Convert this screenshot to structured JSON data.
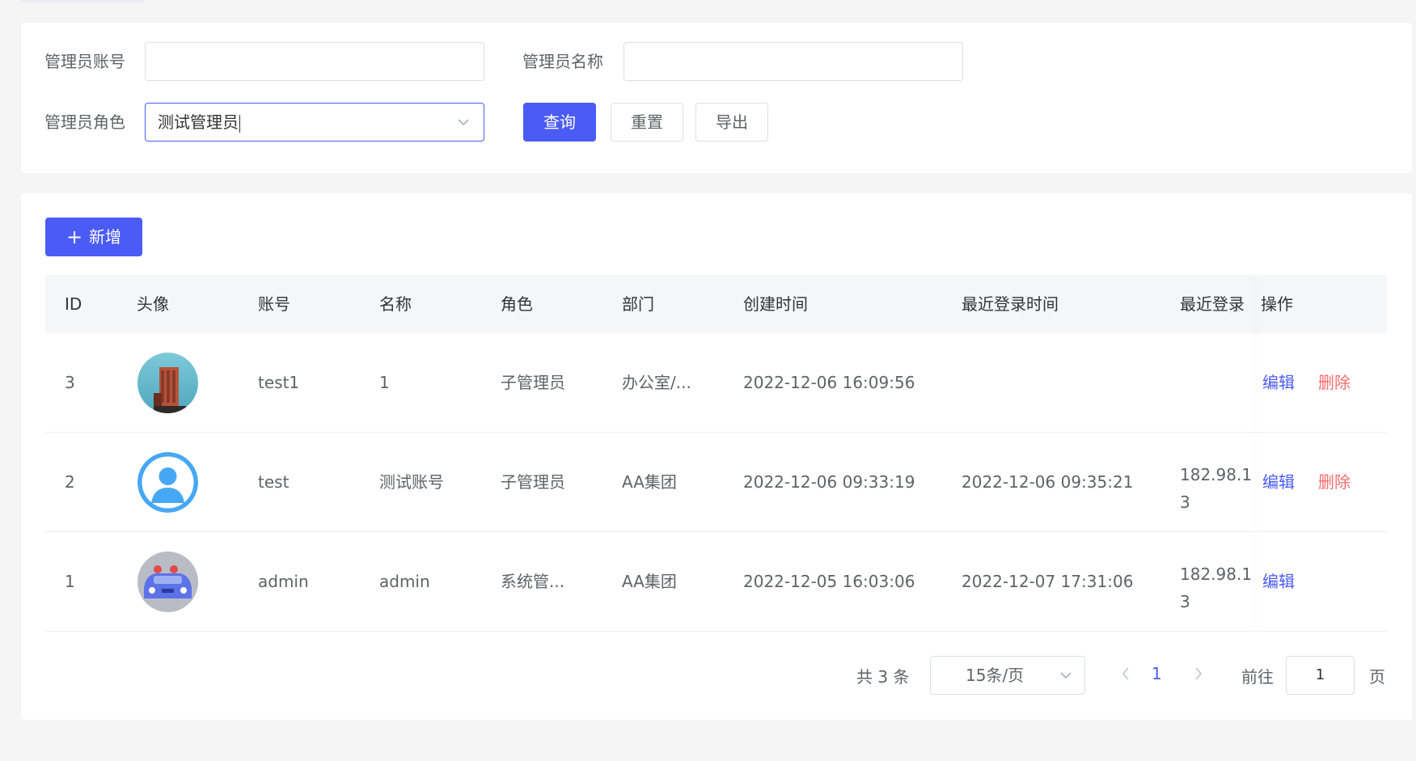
{
  "search": {
    "account_label": "管理员账号",
    "account_value": "",
    "name_label": "管理员名称",
    "name_value": "",
    "role_label": "管理员角色",
    "role_value": "测试管理员",
    "query_btn": "查询",
    "reset_btn": "重置",
    "export_btn": "导出"
  },
  "toolbar": {
    "add_btn": "新增"
  },
  "table": {
    "headers": {
      "id": "ID",
      "avatar": "头像",
      "account": "账号",
      "name": "名称",
      "role": "角色",
      "dept": "部门",
      "created": "创建时间",
      "last_login": "最近登录时间",
      "last_ip": "最近登录",
      "actions": "操作"
    },
    "rows": [
      {
        "id": "3",
        "account": "test1",
        "name": "1",
        "role": "子管理员",
        "dept": "办公室/...",
        "created": "2022-12-06 16:09:56",
        "last_login": "",
        "ip_line1": "",
        "ip_line2": "",
        "edit": "编辑",
        "delete": "删除",
        "avatar_icon": "building-photo-avatar"
      },
      {
        "id": "2",
        "account": "test",
        "name": "测试账号",
        "role": "子管理员",
        "dept": "AA集团",
        "created": "2022-12-06 09:33:19",
        "last_login": "2022-12-06 09:35:21",
        "ip_line1": "182.98.1",
        "ip_line2": "3",
        "edit": "编辑",
        "delete": "删除",
        "avatar_icon": "default-user-avatar"
      },
      {
        "id": "1",
        "account": "admin",
        "name": "admin",
        "role": "系统管...",
        "dept": "AA集团",
        "created": "2022-12-05 16:03:06",
        "last_login": "2022-12-07 17:31:06",
        "ip_line1": "182.98.1",
        "ip_line2": "3",
        "edit": "编辑",
        "delete": "",
        "avatar_icon": "car-photo-avatar"
      }
    ]
  },
  "pagination": {
    "total": "共 3 条",
    "page_size": "15条/页",
    "current_page": "1",
    "goto_label": "前往",
    "goto_value": "1",
    "page_suffix": "页"
  },
  "colors": {
    "primary": "#4b5bf6",
    "danger": "#f56c6c",
    "header_bg": "#f5f6f8",
    "page_bg": "#f5f5f5"
  }
}
